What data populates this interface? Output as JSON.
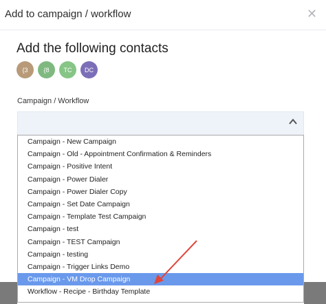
{
  "modal": {
    "title": "Add to campaign / workflow",
    "close_icon": "close-icon",
    "heading": "Add the following contacts",
    "contacts": [
      {
        "initials": "{3",
        "color": "#b89a79"
      },
      {
        "initials": "{8",
        "color": "#7fb980"
      },
      {
        "initials": "TC",
        "color": "#86c586"
      },
      {
        "initials": "DC",
        "color": "#7c6fb8"
      }
    ],
    "field_label": "Campaign / Workflow",
    "select_icon": "chevron-up-icon",
    "options": [
      {
        "label": "Campaign - New Campaign",
        "selected": false
      },
      {
        "label": "Campaign - Old - Appointment Confirmation & Reminders",
        "selected": false
      },
      {
        "label": "Campaign - Positive Intent",
        "selected": false
      },
      {
        "label": "Campaign - Power Dialer",
        "selected": false
      },
      {
        "label": "Campaign - Power Dialer Copy",
        "selected": false
      },
      {
        "label": "Campaign - Set Date Campaign",
        "selected": false
      },
      {
        "label": "Campaign - Template Test Campaign",
        "selected": false
      },
      {
        "label": "Campaign - test",
        "selected": false
      },
      {
        "label": "Campaign - TEST Campaign",
        "selected": false
      },
      {
        "label": "Campaign - testing",
        "selected": false
      },
      {
        "label": "Campaign - Trigger Links Demo",
        "selected": false
      },
      {
        "label": "Campaign - VM Drop Campaign",
        "selected": true
      },
      {
        "label": "Workflow - Recipe - Birthday Template",
        "selected": false
      }
    ]
  },
  "colors": {
    "selected_bg": "#6a99ec",
    "arrow": "#e0463a"
  }
}
